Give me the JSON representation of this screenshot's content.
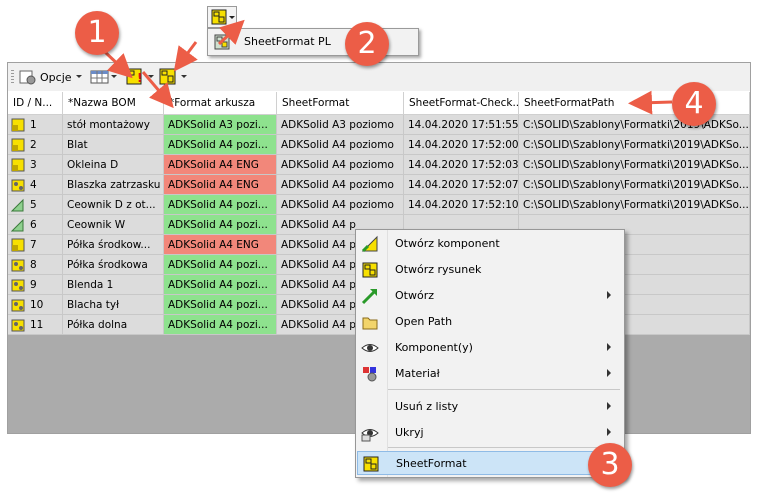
{
  "mini_toolbar": {
    "menu_item_label": "SheetFormat PL"
  },
  "toolbar": {
    "options_label": "Opcje"
  },
  "grid": {
    "headers": [
      "ID / N...",
      "*Nazwa BOM",
      "*Format arkusza",
      "SheetFormat",
      "SheetFormat-Check...",
      "SheetFormatPath"
    ],
    "rows": [
      {
        "id": "1",
        "icon": "part-icon",
        "name": "stół montażowy",
        "format": "ADKSolid A3 pozi...",
        "format_status": "ok",
        "sheet": "ADKSolid A3 poziomo",
        "check": "14.04.2020 17:51:55",
        "path": "C:\\SOLID\\Szablony\\Formatki\\2019\\ADKSo..."
      },
      {
        "id": "2",
        "icon": "part-icon",
        "name": "Blat",
        "format": "ADKSolid A4 pozi...",
        "format_status": "ok",
        "sheet": "ADKSolid A4 poziomo",
        "check": "14.04.2020 17:52:00",
        "path": "C:\\SOLID\\Szablony\\Formatki\\2019\\ADKSo..."
      },
      {
        "id": "3",
        "icon": "part-icon",
        "name": "Okleina D",
        "format": "ADKSolid A4 ENG",
        "format_status": "error",
        "sheet": "ADKSolid A4 poziomo",
        "check": "14.04.2020 17:52:03",
        "path": "C:\\SOLID\\Szablony\\Formatki\\2019\\ADKSo..."
      },
      {
        "id": "4",
        "icon": "assembly-icon",
        "name": "Blaszka zatrzasku",
        "format": "ADKSolid A4 ENG",
        "format_status": "error",
        "sheet": "ADKSolid A4 poziomo",
        "check": "14.04.2020 17:52:07",
        "path": "C:\\SOLID\\Szablony\\Formatki\\2019\\ADKSo..."
      },
      {
        "id": "5",
        "icon": "sheetmetal-icon",
        "name": "Ceownik D z ot...",
        "format": "ADKSolid A4 pozi...",
        "format_status": "ok",
        "sheet": "ADKSolid A4 poziomo",
        "check": "14.04.2020 17:52:10",
        "path": "C:\\SOLID\\Szablony\\Formatki\\2019\\ADKSo..."
      },
      {
        "id": "6",
        "icon": "sheetmetal-icon",
        "name": "Ceownik W",
        "format": "ADKSolid A4 pozi...",
        "format_status": "ok",
        "sheet": "ADKSolid A4 p",
        "check": "",
        "path": ""
      },
      {
        "id": "7",
        "icon": "part-icon",
        "name": "Półka środkow...",
        "format": "ADKSolid A4 ENG",
        "format_status": "error",
        "sheet": "ADKSolid A4 p",
        "check": "",
        "path": ""
      },
      {
        "id": "8",
        "icon": "assembly-icon",
        "name": "Półka środkowa",
        "format": "ADKSolid A4 pozi...",
        "format_status": "ok",
        "sheet": "ADKSolid A4 p",
        "check": "",
        "path": ""
      },
      {
        "id": "9",
        "icon": "assembly-icon",
        "name": "Blenda 1",
        "format": "ADKSolid A4 pozi...",
        "format_status": "ok",
        "sheet": "ADKSolid A4 p",
        "check": "",
        "path": ""
      },
      {
        "id": "10",
        "icon": "assembly-icon",
        "name": "Blacha tył",
        "format": "ADKSolid A4 pozi...",
        "format_status": "ok",
        "sheet": "ADKSolid A4 p",
        "check": "",
        "path": ""
      },
      {
        "id": "11",
        "icon": "assembly-icon",
        "name": "Półka dolna",
        "format": "ADKSolid A4 pozi...",
        "format_status": "ok",
        "sheet": "ADKSolid A4 p",
        "check": "",
        "path": ""
      }
    ]
  },
  "context_menu": {
    "items": [
      {
        "label": "Otwórz komponent",
        "icon": "open-component-icon",
        "submenu": false
      },
      {
        "label": "Otwórz rysunek",
        "icon": "open-drawing-icon",
        "submenu": false
      },
      {
        "label": "Otwórz",
        "icon": "open-arrow-icon",
        "submenu": true
      },
      {
        "label": "Open Path",
        "icon": "folder-icon",
        "submenu": false
      },
      {
        "label": "Komponent(y)",
        "icon": "eye-icon",
        "submenu": true
      },
      {
        "label": "Materiał",
        "icon": "material-icon",
        "submenu": true
      },
      {
        "label": "Usuń z listy",
        "icon": "",
        "submenu": true
      },
      {
        "label": "Ukryj",
        "icon": "hide-icon",
        "submenu": true
      },
      {
        "label": "SheetFormat",
        "icon": "sheetformat-icon",
        "submenu": false,
        "highlighted": true
      }
    ]
  },
  "callouts": [
    "1",
    "2",
    "3",
    "4"
  ],
  "colors": {
    "ok": "#8ee28e",
    "error": "#f2877a",
    "callout": "#ec5d47",
    "highlight": "#cce4f7"
  }
}
